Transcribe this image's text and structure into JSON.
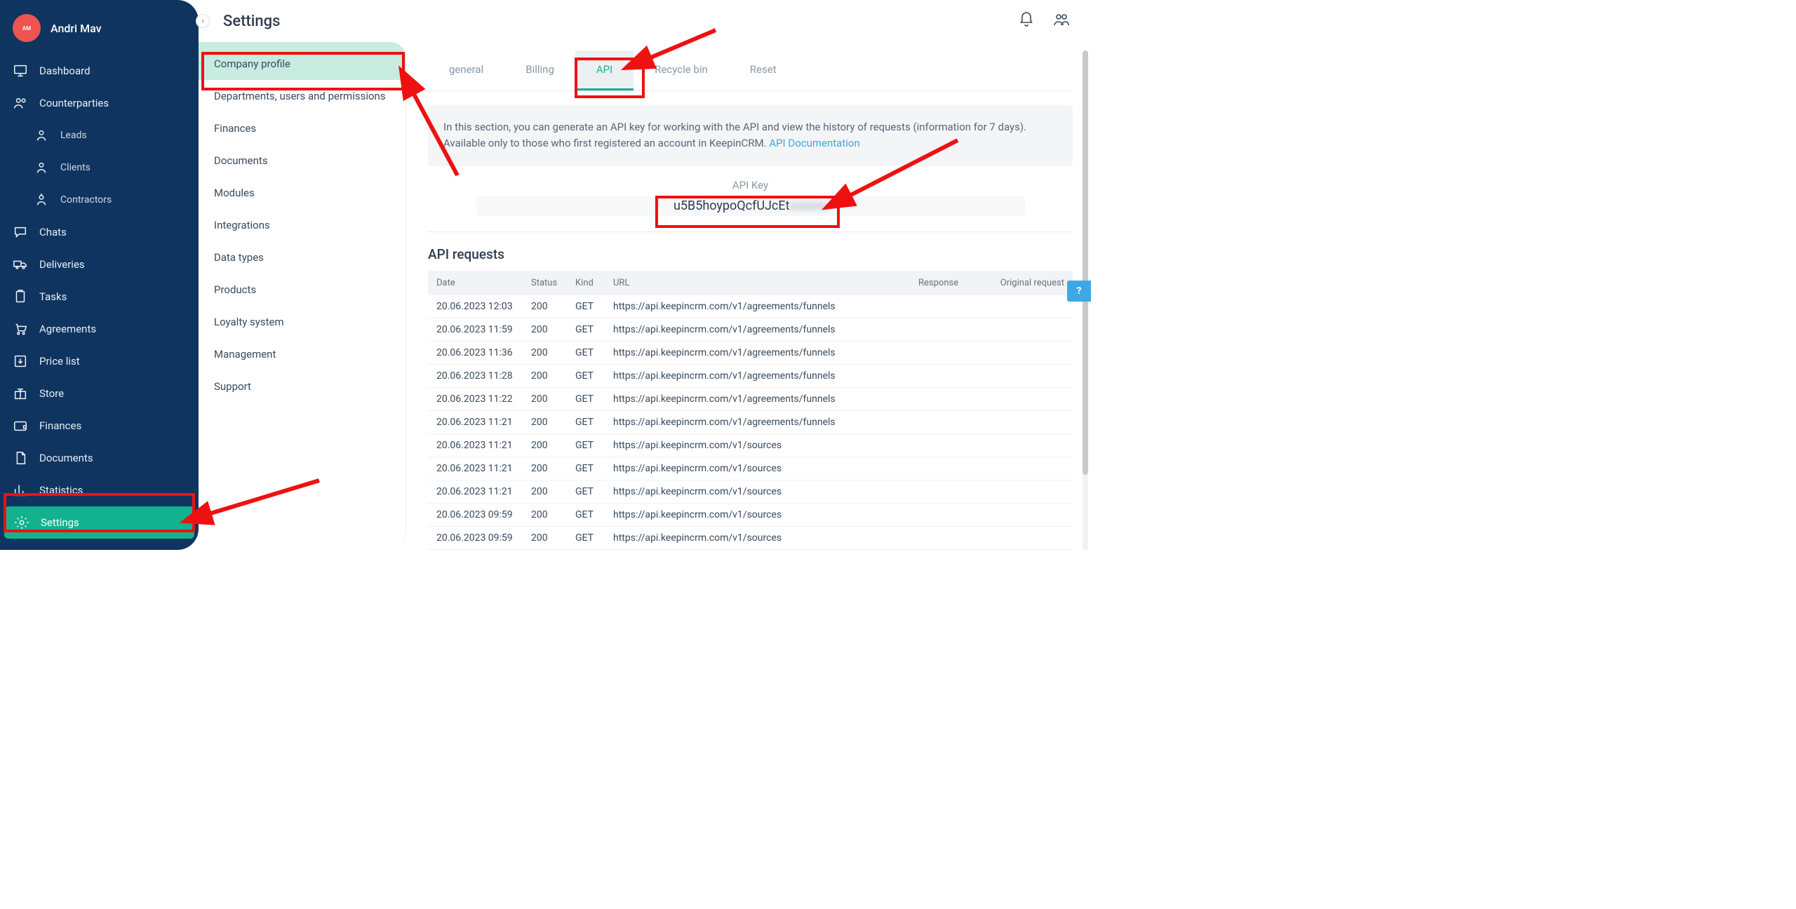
{
  "user": {
    "initials": "AM",
    "name": "Andri Mav"
  },
  "sidebar": {
    "items": [
      {
        "label": "Dashboard",
        "icon": "monitor"
      },
      {
        "label": "Counterparties",
        "icon": "users"
      },
      {
        "label": "Leads",
        "icon": "leads",
        "sub": true
      },
      {
        "label": "Clients",
        "icon": "person",
        "sub": true
      },
      {
        "label": "Contractors",
        "icon": "contractor",
        "sub": true
      },
      {
        "label": "Chats",
        "icon": "chat"
      },
      {
        "label": "Deliveries",
        "icon": "truck"
      },
      {
        "label": "Tasks",
        "icon": "clipboard"
      },
      {
        "label": "Agreements",
        "icon": "cart"
      },
      {
        "label": "Price list",
        "icon": "download"
      },
      {
        "label": "Store",
        "icon": "gift"
      },
      {
        "label": "Finances",
        "icon": "wallet"
      },
      {
        "label": "Documents",
        "icon": "doc"
      },
      {
        "label": "Statistics",
        "icon": "stats"
      },
      {
        "label": "Settings",
        "icon": "gear",
        "active": true
      }
    ]
  },
  "page": {
    "title": "Settings"
  },
  "settings_menu": [
    "Company profile",
    "Departments, users and permissions",
    "Finances",
    "Documents",
    "Modules",
    "Integrations",
    "Data types",
    "Products",
    "Loyalty system",
    "Management",
    "Support"
  ],
  "tabs": [
    {
      "label": "general"
    },
    {
      "label": "Billing"
    },
    {
      "label": "API",
      "active": true
    },
    {
      "label": "Recycle bin"
    },
    {
      "label": "Reset"
    }
  ],
  "info": {
    "text": "In this section, you can generate an API key for working with the API and view the history of requests (information for 7 days). Available only to those who first registered an account in KeepinCRM. ",
    "link_text": "API Documentation"
  },
  "api_key": {
    "label": "API Key",
    "visible": "u5B5hoypoQcfUJcEt",
    "hidden": "xxxxxx"
  },
  "requests": {
    "title": "API requests",
    "headers": {
      "date": "Date",
      "status": "Status",
      "kind": "Kind",
      "url": "URL",
      "response": "Response",
      "original": "Original request"
    },
    "rows": [
      {
        "date": "20.06.2023 12:03",
        "status": "200",
        "kind": "GET",
        "url": "https://api.keepincrm.com/v1/agreements/funnels"
      },
      {
        "date": "20.06.2023 11:59",
        "status": "200",
        "kind": "GET",
        "url": "https://api.keepincrm.com/v1/agreements/funnels"
      },
      {
        "date": "20.06.2023 11:36",
        "status": "200",
        "kind": "GET",
        "url": "https://api.keepincrm.com/v1/agreements/funnels"
      },
      {
        "date": "20.06.2023 11:28",
        "status": "200",
        "kind": "GET",
        "url": "https://api.keepincrm.com/v1/agreements/funnels"
      },
      {
        "date": "20.06.2023 11:22",
        "status": "200",
        "kind": "GET",
        "url": "https://api.keepincrm.com/v1/agreements/funnels"
      },
      {
        "date": "20.06.2023 11:21",
        "status": "200",
        "kind": "GET",
        "url": "https://api.keepincrm.com/v1/agreements/funnels"
      },
      {
        "date": "20.06.2023 11:21",
        "status": "200",
        "kind": "GET",
        "url": "https://api.keepincrm.com/v1/sources"
      },
      {
        "date": "20.06.2023 11:21",
        "status": "200",
        "kind": "GET",
        "url": "https://api.keepincrm.com/v1/sources"
      },
      {
        "date": "20.06.2023 11:21",
        "status": "200",
        "kind": "GET",
        "url": "https://api.keepincrm.com/v1/sources"
      },
      {
        "date": "20.06.2023 09:59",
        "status": "200",
        "kind": "GET",
        "url": "https://api.keepincrm.com/v1/sources"
      },
      {
        "date": "20.06.2023 09:59",
        "status": "200",
        "kind": "GET",
        "url": "https://api.keepincrm.com/v1/sources"
      }
    ]
  },
  "help": "?"
}
